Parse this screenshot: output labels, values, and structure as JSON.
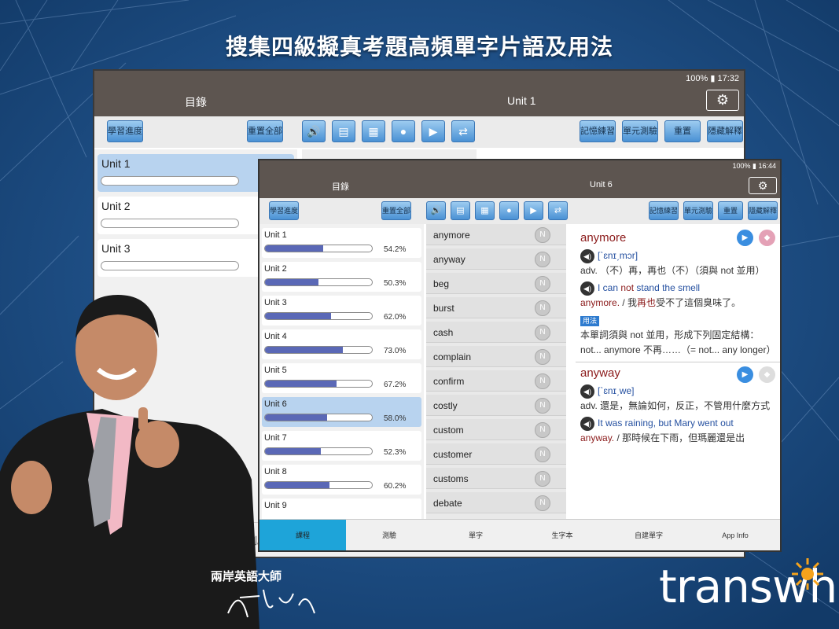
{
  "headline": "搜集四級擬真考題高頻單字片語及用法",
  "back_tablet": {
    "status": "100% ▮ 17:32",
    "left_title": "目錄",
    "center_title": "Unit 1",
    "buttons": {
      "progress": "學習進度",
      "reset_all": "重置全部",
      "memory": "記憶練習",
      "unit_test": "單元測驗",
      "reset": "重置",
      "hide": "隱藏解釋"
    },
    "units": [
      {
        "label": "Unit 1"
      },
      {
        "label": "Unit 2"
      },
      {
        "label": "Unit 3"
      }
    ],
    "tab_test": "測驗"
  },
  "front_tablet": {
    "status": "100% ▮ 16:44",
    "left_title": "目錄",
    "center_title": "Unit 6",
    "buttons": {
      "progress": "學習進度",
      "reset_all": "重置全部",
      "memory": "記憶練習",
      "unit_test": "單元測驗",
      "reset": "重置",
      "hide": "隱藏解釋"
    },
    "units": [
      {
        "label": "Unit 1",
        "percent": "54.2%",
        "value": 54.2
      },
      {
        "label": "Unit 2",
        "percent": "50.3%",
        "value": 50.3
      },
      {
        "label": "Unit 3",
        "percent": "62.0%",
        "value": 62.0
      },
      {
        "label": "Unit 4",
        "percent": "73.0%",
        "value": 73.0
      },
      {
        "label": "Unit 5",
        "percent": "67.2%",
        "value": 67.2
      },
      {
        "label": "Unit 6",
        "percent": "58.0%",
        "value": 58.0
      },
      {
        "label": "Unit 7",
        "percent": "52.3%",
        "value": 52.3
      },
      {
        "label": "Unit 8",
        "percent": "60.2%",
        "value": 60.2
      },
      {
        "label": "Unit 9",
        "percent": "",
        "value": 0
      }
    ],
    "words": [
      "anymore",
      "anyway",
      "beg",
      "burst",
      "cash",
      "complain",
      "confirm",
      "costly",
      "custom",
      "customer",
      "customs",
      "debate"
    ],
    "definition": {
      "word1": "anymore",
      "phon1": "[ˋɛnɪˏmɔr]",
      "def1": "adv. （不）再，再也（不）（須與 not 並用）",
      "ex1_en_a": "I can ",
      "ex1_en_not": "not",
      "ex1_en_b": " stand the smell",
      "ex1_en2": "anymore.",
      "ex1_zh_a": " / 我",
      "ex1_zh_red": "再也",
      "ex1_zh_b": "受不了這個臭味了。",
      "usage_tag": "用法",
      "usage1": "本單詞須與 not 並用，形成下列固定結構：",
      "usage2": "not... anymore 不再……（= not... any longer）",
      "word2": "anyway",
      "phon2": "[ˋɛnɪˏwe]",
      "def2": "adv. 還是，無論如何，反正，不管用什麼方式",
      "ex2_en": "It was raining, but Mary went out",
      "ex2_en2": "anyway.",
      "ex2_zh": " / 那時候在下雨，但瑪麗還是出"
    },
    "tabs": [
      "課程",
      "測驗",
      "單字",
      "生字本",
      "自建單字",
      "App Info"
    ]
  },
  "caption": "兩岸英語大師",
  "brand": "transwhiz"
}
